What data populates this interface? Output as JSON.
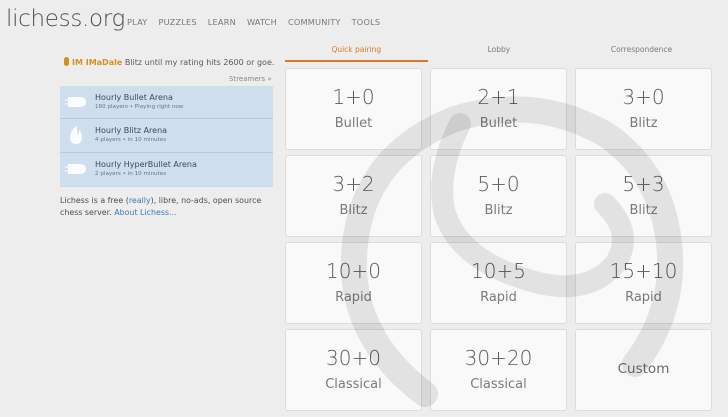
{
  "header": {
    "logo": "lichess.org",
    "nav": [
      "PLAY",
      "PUZZLES",
      "LEARN",
      "WATCH",
      "COMMUNITY",
      "TOOLS"
    ]
  },
  "streamer": {
    "name": "IM IMaDale",
    "text": "Blitz until my rating hits 2600 or goe...",
    "link": "Streamers »"
  },
  "tournaments": [
    {
      "title": "Hourly Bullet Arena",
      "meta": "180 players • Playing right now",
      "icon": "bullet-icon"
    },
    {
      "title": "Hourly Blitz Arena",
      "meta": "4 players • in 10 minutes",
      "icon": "fire-icon"
    },
    {
      "title": "Hourly HyperBullet Arena",
      "meta": "2 players • in 10 minutes",
      "icon": "bullet-icon"
    }
  ],
  "about": {
    "part1": "Lichess is a free (",
    "really": "really",
    "part2": "), libre, no-ads, open source chess server. ",
    "link": "About Lichess..."
  },
  "tabs": [
    "Quick pairing",
    "Lobby",
    "Correspondence"
  ],
  "active_tab": "Quick pairing",
  "pairings": [
    {
      "clock": "1+0",
      "perf": "Bullet"
    },
    {
      "clock": "2+1",
      "perf": "Bullet"
    },
    {
      "clock": "3+0",
      "perf": "Blitz"
    },
    {
      "clock": "3+2",
      "perf": "Blitz"
    },
    {
      "clock": "5+0",
      "perf": "Blitz"
    },
    {
      "clock": "5+3",
      "perf": "Blitz"
    },
    {
      "clock": "10+0",
      "perf": "Rapid"
    },
    {
      "clock": "10+5",
      "perf": "Rapid"
    },
    {
      "clock": "15+10",
      "perf": "Rapid"
    },
    {
      "clock": "30+0",
      "perf": "Classical"
    },
    {
      "clock": "30+20",
      "perf": "Classical"
    }
  ],
  "custom_label": "Custom",
  "colors": {
    "accent": "#d9782c",
    "link": "#3b79ba",
    "streamer": "#d59020",
    "tournament_bg": "#cfdeec"
  }
}
